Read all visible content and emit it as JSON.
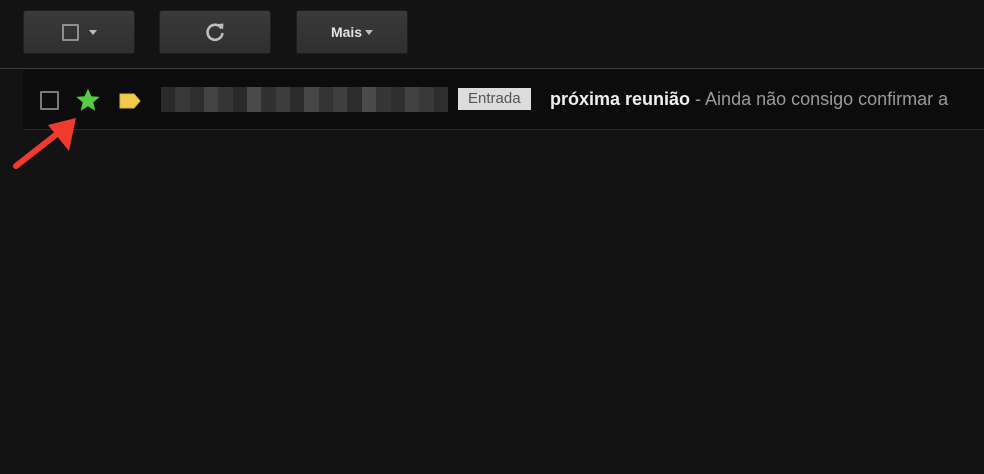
{
  "toolbar": {
    "select_icon": "checkbox-icon",
    "refresh_icon": "refresh-icon",
    "more_label": "Mais"
  },
  "message": {
    "starred": true,
    "star_color": "#55cc44",
    "label_color": "#f2c94c",
    "folder_badge": "Entrada",
    "subject": "próxima reunião",
    "snippet": " - Ainda não consigo confirmar a"
  },
  "annotation": {
    "arrow_color": "#f03a2e"
  }
}
